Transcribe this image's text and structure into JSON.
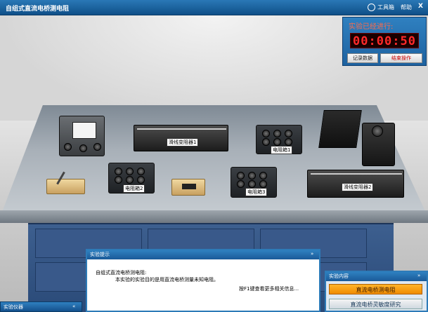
{
  "window": {
    "title": "自组式直流电桥测电阻"
  },
  "titlebar": {
    "tools_label": "工具箱",
    "help_label": "帮助",
    "close_label": "X"
  },
  "timer": {
    "label": "实验已经进行:",
    "display": "00:00:50",
    "record_label": "记录数据",
    "end_label": "结束操作"
  },
  "equipment": {
    "rheostat1_label": "滑线变阻器1",
    "rheostat2_label": "滑线变阻器2",
    "box1_label": "电阻箱1",
    "box2_label": "电阻箱2",
    "box3_label": "电阻箱3"
  },
  "instrument_panel": {
    "title": "实验仪器",
    "chevron": "«"
  },
  "hint_panel": {
    "title": "实验提示",
    "chevron": "»",
    "heading": "自组式直流电桥测电阻:",
    "body": "本实验的实验目的是用直流电桥测量未知电阻。",
    "more": "按F1键查看更多相关信息..."
  },
  "content_panel": {
    "title": "实验内容",
    "chevron": "»",
    "items": [
      "直流电桥测电阻",
      "直流电桥灵敏度研究"
    ]
  },
  "colors": {
    "titlebar": "#1e62a0",
    "timer_digits": "#ff2a2a",
    "active_item": "#f39c12"
  },
  "icons": [
    "gear-icon",
    "close-icon"
  ]
}
